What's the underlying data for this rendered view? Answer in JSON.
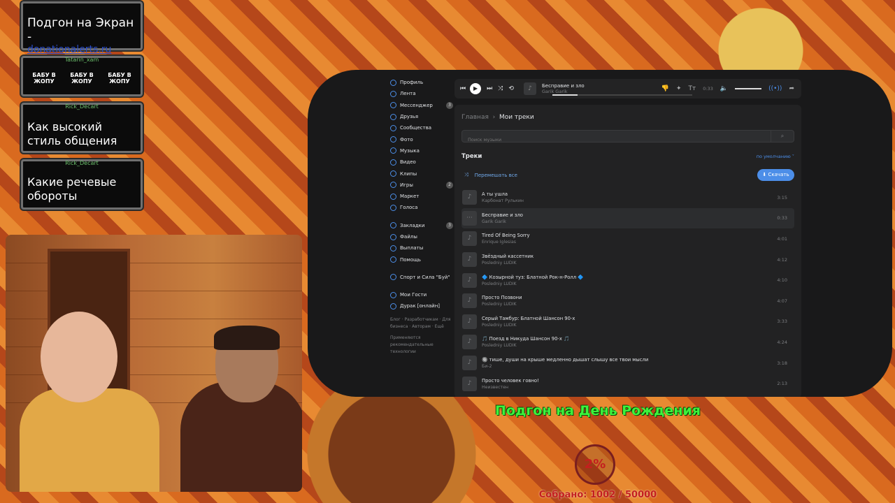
{
  "overlay": {
    "card1": {
      "title": "Подгон на Экран -",
      "link": "donationalerts.ru"
    },
    "card2": {
      "user": "Tatarin_xam",
      "stickers": [
        "БАБУ В ЖОПУ",
        "БАБУ В ЖОПУ",
        "БАБУ В ЖОПУ"
      ]
    },
    "card3": {
      "user": "Rick_Decart",
      "text": "Как высокий стиль общения"
    },
    "card4": {
      "user": "Rick_Decart",
      "text": "Какие речевые обороты"
    }
  },
  "sidebar": {
    "items": [
      {
        "label": "Профиль",
        "badge": ""
      },
      {
        "label": "Лента",
        "badge": ""
      },
      {
        "label": "Мессенджер",
        "badge": "3"
      },
      {
        "label": "Друзья",
        "badge": ""
      },
      {
        "label": "Сообщества",
        "badge": ""
      },
      {
        "label": "Фото",
        "badge": ""
      },
      {
        "label": "Музыка",
        "badge": ""
      },
      {
        "label": "Видео",
        "badge": ""
      },
      {
        "label": "Клипы",
        "badge": ""
      },
      {
        "label": "Игры",
        "badge": "2"
      },
      {
        "label": "Маркет",
        "badge": ""
      },
      {
        "label": "Голоса",
        "badge": ""
      }
    ],
    "items2": [
      {
        "label": "Закладки",
        "badge": "3"
      },
      {
        "label": "Файлы",
        "badge": ""
      },
      {
        "label": "Выплаты",
        "badge": ""
      },
      {
        "label": "Помощь",
        "badge": ""
      }
    ],
    "group": "Спорт и Сила \"Буй\"",
    "items3": [
      {
        "label": "Мои Гости"
      },
      {
        "label": "Дурак [онлайн]"
      }
    ],
    "footer_links": "Блог · Разработчикам · Для бизнеса · Авторам · Ещё",
    "footer_note": "Применяются рекомендательные технологии"
  },
  "player": {
    "track_title": "Бесправие и зло",
    "track_artist": "Garik Garik",
    "time": "0:33",
    "progress": 0.18,
    "volume": 1.0
  },
  "main": {
    "breadcrumb_home": "Главная",
    "breadcrumb_current": "Мои треки",
    "search_placeholder": "Поиск музыки",
    "section_title": "Треки",
    "sort_label": "по умолчанию",
    "shuffle_label": "Перемешать все",
    "download_label": "Скачать"
  },
  "tracks": [
    {
      "title": "А ты ушла",
      "artist": "Карбонат Рулькин",
      "duration": "3:15"
    },
    {
      "title": "Бесправие и зло",
      "artist": "Garik Garik",
      "duration": "0:33",
      "active": true
    },
    {
      "title": "Tired Of Being Sorry",
      "artist": "Enrique Iglesias",
      "duration": "4:01"
    },
    {
      "title": "Звёздный кассетник",
      "artist": "Posledniy LUDIK",
      "duration": "4:12"
    },
    {
      "title": "🔷 Козырной туз: Блатной Рок-н-Ролл 🔷",
      "artist": "Posledniy LUDIK",
      "duration": "4:10"
    },
    {
      "title": "Просто Позвони",
      "artist": "Posledniy LUDIK",
      "duration": "4:07"
    },
    {
      "title": "Серый Тамбур: Блатной Шансон 90-х",
      "artist": "Posledniy LUDIK",
      "duration": "3:33"
    },
    {
      "title": "🎵 Поезд в Никуда Шансон 90-х 🎵",
      "artist": "Posledniy LUDIK",
      "duration": "4:24"
    },
    {
      "title": "🔘 тише, души на крыше медленно дышат слышу все твои мысли",
      "artist": "Би-2",
      "duration": "3:18"
    },
    {
      "title": "Просто человек говно!",
      "artist": "Неизвестен",
      "duration": "2:13"
    }
  ],
  "goal": {
    "title": "Подгон на День Рождения",
    "percent": "2%",
    "collected": "Собрано: 1002 / 50000"
  },
  "colors": {
    "accent": "#4c8ee8",
    "goal_green": "#3cf23c",
    "goal_red": "#c41f1f"
  }
}
